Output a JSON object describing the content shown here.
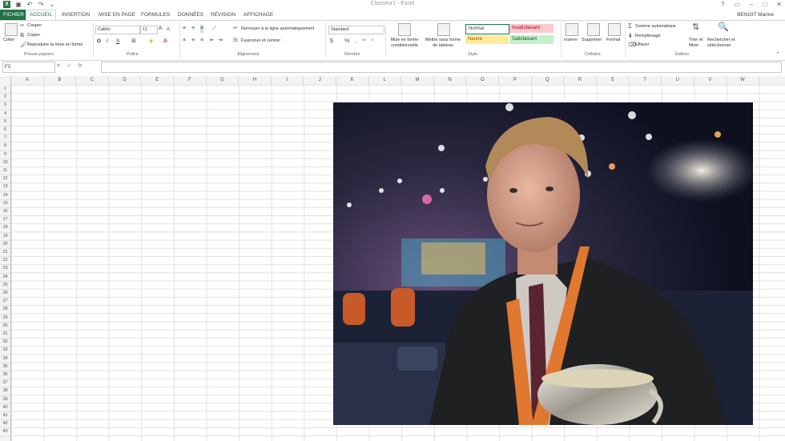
{
  "app": {
    "title": "Classeur1 - Excel",
    "user": "BENOIT Marine"
  },
  "tabs": [
    "FICHIER",
    "ACCUEIL",
    "INSERTION",
    "MISE EN PAGE",
    "FORMULES",
    "DONNÉES",
    "RÉVISION",
    "AFFICHAGE"
  ],
  "ribbon": {
    "clipboard": {
      "paste": "Coller",
      "cut": "Couper",
      "copy": "Copier",
      "format_painter": "Reproduire la mise en forme",
      "label": "Presse-papiers"
    },
    "font": {
      "name": "Calibri",
      "size": "11",
      "bold": "G",
      "italic": "I",
      "underline": "S",
      "label": "Police"
    },
    "alignment": {
      "wrap": "Renvoyer à la ligne automatiquement",
      "merge": "Fusionner et centrer",
      "label": "Alignement"
    },
    "number": {
      "format": "Standard",
      "label": "Nombre"
    },
    "styles": {
      "conditional": "Mise en forme conditionnelle",
      "table": "Mettre sous forme de tableau",
      "normal": "Normal",
      "bad": "Insatisfaisant",
      "neutral": "Neutre",
      "good": "Satisfaisant",
      "label": "Style"
    },
    "cells": {
      "insert": "Insérer",
      "delete": "Supprimer",
      "format": "Format",
      "label": "Cellules"
    },
    "editing": {
      "autosum": "Somme automatique",
      "fill": "Remplissage",
      "clear": "Effacer",
      "sort": "Trier et filtrer",
      "find": "Rechercher et sélectionner",
      "label": "Édition"
    }
  },
  "formula_bar": {
    "name_box": "F3",
    "fx": "fx",
    "value": ""
  },
  "columns": [
    "A",
    "B",
    "C",
    "D",
    "E",
    "F",
    "G",
    "H",
    "I",
    "J",
    "K",
    "L",
    "M",
    "N",
    "O",
    "P",
    "Q",
    "R",
    "S",
    "T",
    "U",
    "V",
    "W"
  ],
  "rows": [
    "1",
    "2",
    "3",
    "4",
    "5",
    "6",
    "7",
    "8",
    "9",
    "10",
    "11",
    "12",
    "13",
    "14",
    "15",
    "16",
    "17",
    "18",
    "19",
    "20",
    "21",
    "22",
    "23",
    "24",
    "25",
    "26",
    "27",
    "28",
    "29",
    "30",
    "31",
    "32",
    "33",
    "34",
    "35",
    "36",
    "37",
    "38",
    "39",
    "40",
    "41",
    "42",
    "43"
  ],
  "colors": {
    "excel_green": "#217346",
    "bad_fill": "#ffc7ce",
    "neutral_fill": "#ffeb9c",
    "good_fill": "#c6efce"
  }
}
